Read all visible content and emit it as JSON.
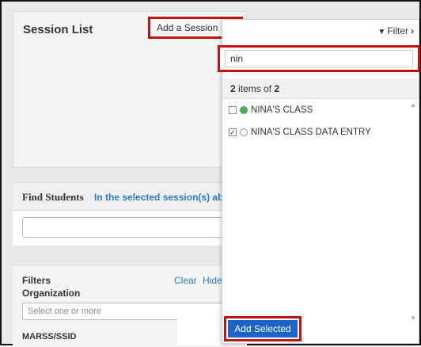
{
  "session_panel": {
    "title": "Session List",
    "add_session_label": "Add a Session"
  },
  "find_students": {
    "label": "Find Students",
    "link": "In the selected session(s) ab"
  },
  "filters": {
    "title": "Filters",
    "organization_label": "Organization",
    "clear_label": "Clear",
    "hide_label": "Hide",
    "org_placeholder": "Select one or more",
    "marss_label": "MARSS/SSID"
  },
  "dropdown": {
    "filter_label": "Filter",
    "search_value": "nin",
    "count_shown": "2",
    "count_of": "items of",
    "count_total": "2",
    "options": [
      {
        "label": "NINA'S CLASS",
        "checked": false,
        "dot": "green"
      },
      {
        "label": "NINA'S CLASS DATA ENTRY",
        "checked": true,
        "dot": "hollow"
      }
    ],
    "add_selected_label": "Add Selected"
  },
  "colors": {
    "highlight": "#c0140f",
    "link": "#2a7bbf",
    "primary_button": "#1b63c5",
    "status_green": "#4caf50"
  }
}
